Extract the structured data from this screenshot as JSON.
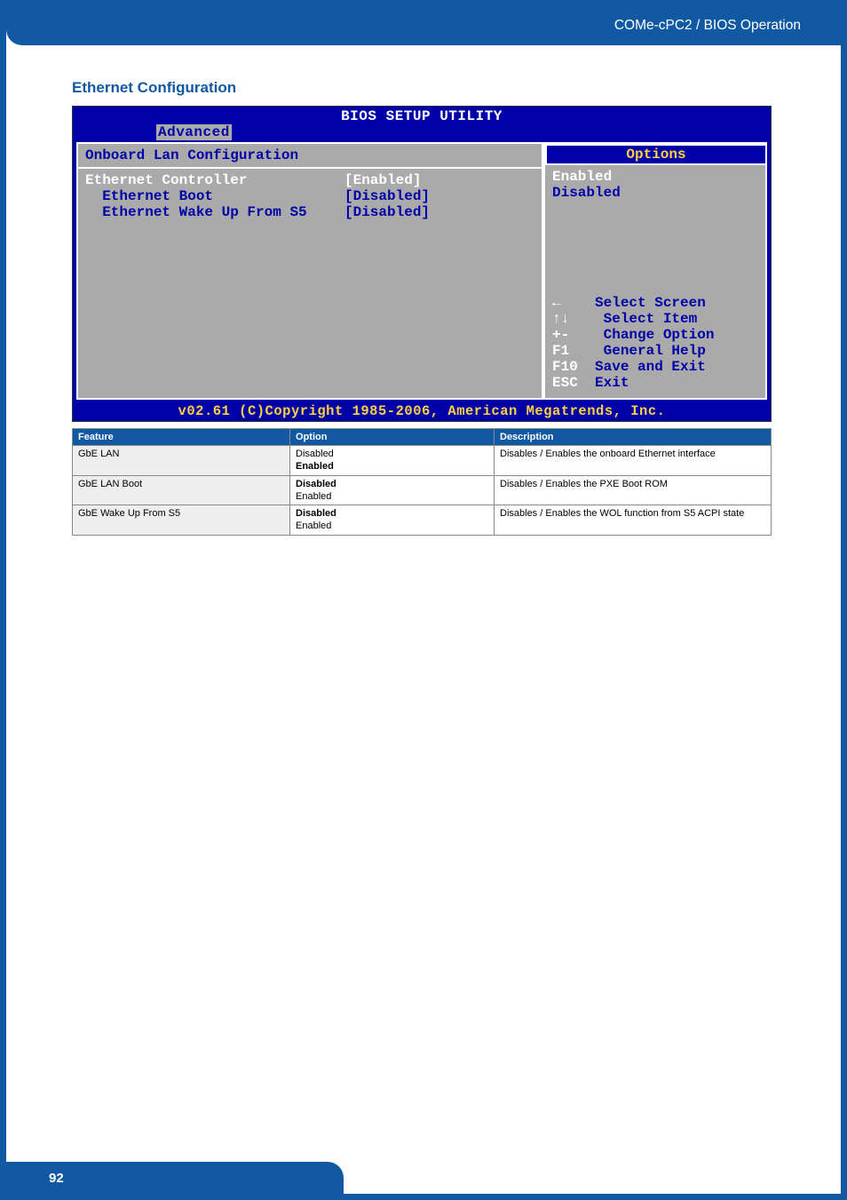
{
  "header": {
    "path": "COMe-cPC2 / BIOS Operation"
  },
  "section": {
    "title": "Ethernet Configuration"
  },
  "bios": {
    "title": "BIOS SETUP UTILITY",
    "tab": "Advanced",
    "left_heading": "Onboard Lan Configuration",
    "items": [
      {
        "label": "Ethernet Controller",
        "value": "[Enabled]",
        "selected": true,
        "indent": 0
      },
      {
        "label": "Ethernet Boot",
        "value": "[Disabled]",
        "selected": false,
        "indent": 1
      },
      {
        "label": "Ethernet Wake Up From S5",
        "value": "[Disabled]",
        "selected": false,
        "indent": 1
      }
    ],
    "options_header": "Options",
    "options": [
      {
        "label": "Enabled",
        "selected": true
      },
      {
        "label": "Disabled",
        "selected": false
      }
    ],
    "keys": [
      {
        "key": "←",
        "desc": "Select Screen"
      },
      {
        "key": "↑↓",
        "desc": " Select Item"
      },
      {
        "key": "+-",
        "desc": " Change Option"
      },
      {
        "key": "F1",
        "desc": " General Help"
      },
      {
        "key": "F10",
        "desc": "Save and Exit"
      },
      {
        "key": "ESC",
        "desc": "Exit"
      }
    ],
    "footer": "v02.61 (C)Copyright 1985-2006, American Megatrends, Inc."
  },
  "table": {
    "headers": [
      "Feature",
      "Option",
      "Description"
    ],
    "rows": [
      {
        "feature": "GbE LAN",
        "options": [
          "Disabled",
          "Enabled"
        ],
        "bold_index": 1,
        "description": "Disables / Enables the onboard Ethernet interface"
      },
      {
        "feature": "GbE LAN Boot",
        "options": [
          "Disabled",
          "Enabled"
        ],
        "bold_index": 0,
        "description": "Disables / Enables the PXE Boot ROM"
      },
      {
        "feature": "GbE Wake Up From S5",
        "options": [
          "Disabled",
          "Enabled"
        ],
        "bold_index": 0,
        "description": "Disables / Enables the WOL function from S5 ACPI state"
      }
    ]
  },
  "footer": {
    "page_number": "92"
  }
}
